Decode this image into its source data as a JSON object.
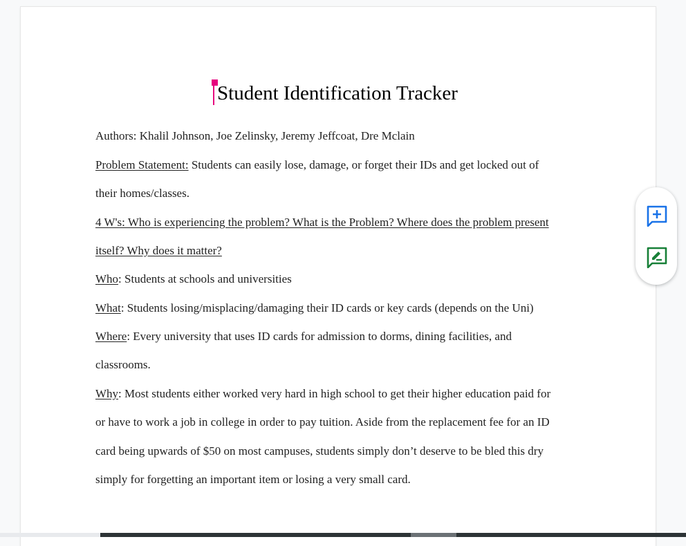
{
  "document": {
    "title": "Student Identification Tracker",
    "authors": "Authors: Khalil Johnson, Joe Zelinsky, Jeremy Jeffcoat, Dre Mclain",
    "problem_label": "Problem Statement:",
    "problem_text_1": " Students can easily lose, damage, or forget their IDs and get locked out of",
    "problem_text_2": "their homes/classes.",
    "four_ws_1": "4 W's: Who is experiencing the problem?  What is the Problem? Where does the problem present",
    "four_ws_2": "itself? Why does it matter?",
    "who_label": "Who",
    "who_text": ": Students at schools and universities",
    "what_label": "What",
    "what_text": ": Students losing/misplacing/damaging their ID cards or key cards (depends on the Uni)",
    "where_label": "Where",
    "where_text_1": ": Every university that uses ID cards for admission to dorms, dining facilities, and",
    "where_text_2": "classrooms.",
    "why_label": "Why",
    "why_text_1": ": Most students either worked very hard in high school to get their higher education paid for",
    "why_text_2": "or have to work a job in college in order to pay tuition. Aside from the replacement fee for an ID",
    "why_text_3": "card being upwards of $50 on most campuses, students simply don’t deserve to be bled this dry",
    "why_text_4": "simply for forgetting an important item or losing a very small card."
  },
  "side_actions": {
    "add_comment_icon": "add-comment-icon",
    "suggest_edit_icon": "suggest-edit-icon",
    "comment_color": "#1a73e8",
    "suggest_color": "#188038"
  },
  "colors": {
    "cursor": "#e6007e"
  }
}
